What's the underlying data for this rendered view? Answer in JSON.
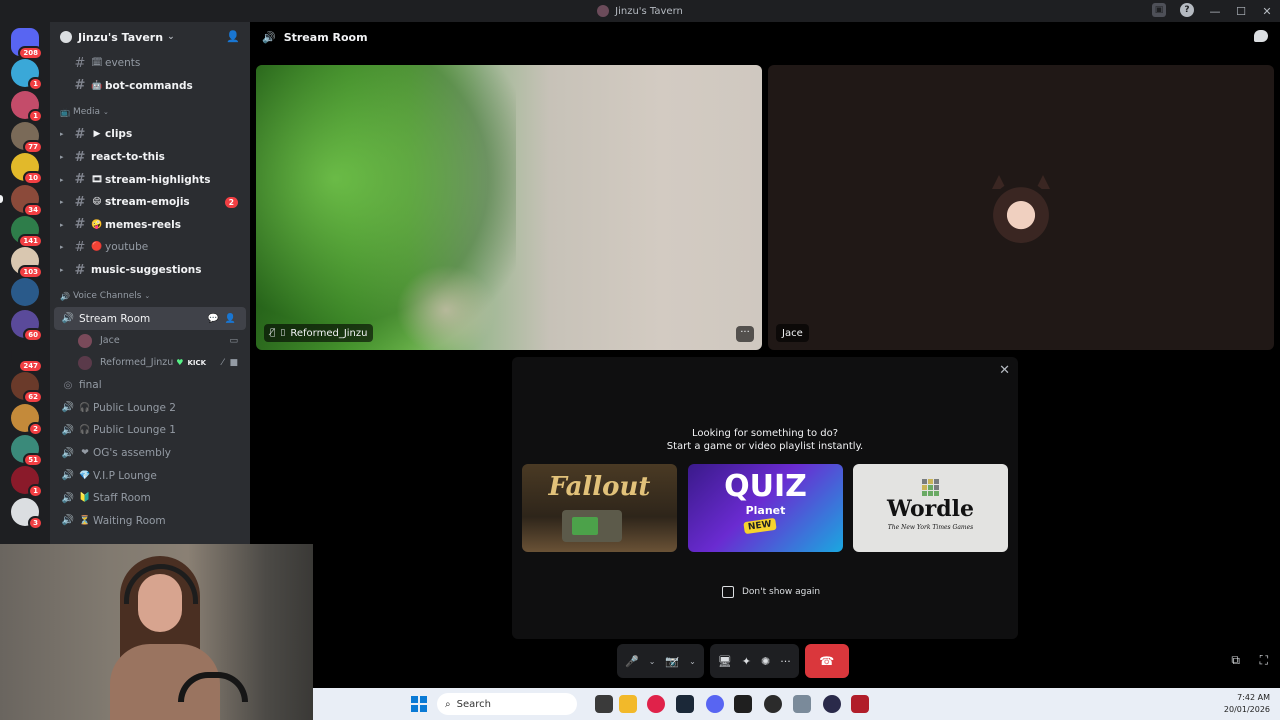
{
  "window": {
    "title": "Jinzu's Tavern",
    "controls": [
      "—",
      "☐",
      "✕"
    ]
  },
  "server_rail": {
    "servers": [
      {
        "name": "home",
        "badge": "208",
        "color": "#5865f2"
      },
      {
        "name": "server-2",
        "badge": "1",
        "color": "#3aa8d8"
      },
      {
        "name": "server-3",
        "badge": "1",
        "color": "#c44c6a"
      },
      {
        "name": "server-4",
        "badge": "77",
        "color": "#7a6a58"
      },
      {
        "name": "server-5",
        "badge": "10",
        "color": "#e2b92a"
      },
      {
        "name": "server-6",
        "badge": "34",
        "color": "#8b4a3a"
      },
      {
        "name": "server-7",
        "badge": "141",
        "color": "#2e7d4a"
      },
      {
        "name": "server-8",
        "badge": "103",
        "color": "#d9c7b0"
      },
      {
        "name": "server-9",
        "badge": "",
        "color": "#2a5a8a"
      },
      {
        "name": "server-10",
        "badge": "60",
        "color": "#5a4a9a"
      },
      {
        "name": "server-11",
        "badge": "247",
        "color": "#1e1f22"
      },
      {
        "name": "server-12",
        "badge": "62",
        "color": "#6a3a2a"
      },
      {
        "name": "server-13",
        "badge": "2",
        "color": "#c48a3a"
      },
      {
        "name": "server-14",
        "badge": "51",
        "color": "#3a8a7a"
      },
      {
        "name": "server-15",
        "badge": "1",
        "color": "#8a1a2a"
      },
      {
        "name": "server-16",
        "badge": "3",
        "color": "#dbdee1"
      }
    ]
  },
  "sidebar": {
    "server_name": "Jinzu's Tavern",
    "channels_top": [
      {
        "name": "events",
        "emoji": "🗓",
        "unread": false
      },
      {
        "name": "bot-commands",
        "emoji": "🤖",
        "unread": true
      }
    ],
    "media_category": "Media",
    "media_channels": [
      {
        "name": "clips",
        "emoji": "▶",
        "unread": true,
        "badge": ""
      },
      {
        "name": "react-to-this",
        "emoji": "",
        "unread": true,
        "badge": ""
      },
      {
        "name": "stream-highlights",
        "emoji": "🎞",
        "unread": true,
        "badge": ""
      },
      {
        "name": "stream-emojis",
        "emoji": "😄",
        "unread": true,
        "badge": "2"
      },
      {
        "name": "memes-reels",
        "emoji": "🤪",
        "unread": true,
        "badge": ""
      },
      {
        "name": "youtube",
        "emoji": "🔴",
        "unread": false,
        "badge": ""
      },
      {
        "name": "music-suggestions",
        "emoji": "",
        "unread": true,
        "badge": ""
      }
    ],
    "voice_category": "Voice Channels",
    "active_voice": "Stream Room",
    "voice_users": [
      {
        "name": "Jace",
        "color": "#7a4a5a"
      },
      {
        "name": "Reformed_Jinzu",
        "color": "#5a3a4a",
        "tag": "KICK"
      }
    ],
    "voice_channels": [
      {
        "name": "final",
        "emoji": ""
      },
      {
        "name": "Public Lounge 2",
        "emoji": "🎧"
      },
      {
        "name": "Public Lounge 1",
        "emoji": "🎧"
      },
      {
        "name": "OG's assembly",
        "emoji": "❤"
      },
      {
        "name": "V.I.P Lounge",
        "emoji": "💎"
      },
      {
        "name": "Staff Room",
        "emoji": "🔰"
      },
      {
        "name": "Waiting Room",
        "emoji": "⏳"
      }
    ]
  },
  "stage": {
    "channel_name": "Stream Room",
    "tiles": [
      {
        "name": "Reformed_Jinzu"
      },
      {
        "name": "Jace"
      }
    ]
  },
  "activity": {
    "line1": "Looking for something to do?",
    "line2": "Start a game or video playlist instantly.",
    "cards": [
      {
        "title": "Fallout"
      },
      {
        "title": "QUIZ",
        "subtitle": "Planet",
        "tag": "NEW"
      },
      {
        "title": "Wordle",
        "subtitle": "The New York Times Games"
      }
    ],
    "dont_show": "Don't show again"
  },
  "taskbar": {
    "search_placeholder": "Search",
    "time": "7:42 AM",
    "date": "20/01/2026"
  }
}
